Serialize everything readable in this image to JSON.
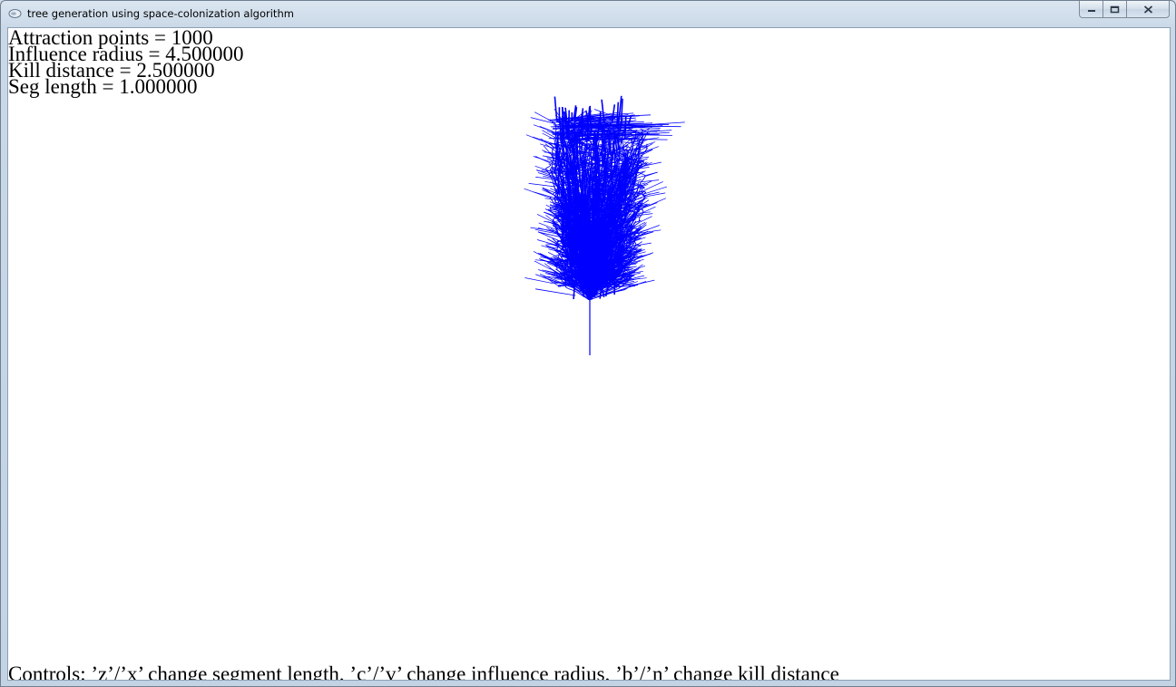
{
  "window": {
    "title": "tree generation using space-colonization algorithm",
    "app_icon": "opengl-app-icon",
    "buttons": {
      "minimize": "minimize-icon",
      "maximize": "maximize-icon",
      "close": "close-icon"
    }
  },
  "params": {
    "attraction_points": "Attraction points = 1000",
    "influence_radius": "Influence radius = 4.500000",
    "kill_distance": "Kill distance = 2.500000",
    "seg_length": "Seg length = 1.000000"
  },
  "controls_text": "Controls: ’z’/’x’ change segment length, ’c’/’v’ change influence radius, ’b’/’n’ change kill distance",
  "tree": {
    "color": "#0000ff"
  }
}
